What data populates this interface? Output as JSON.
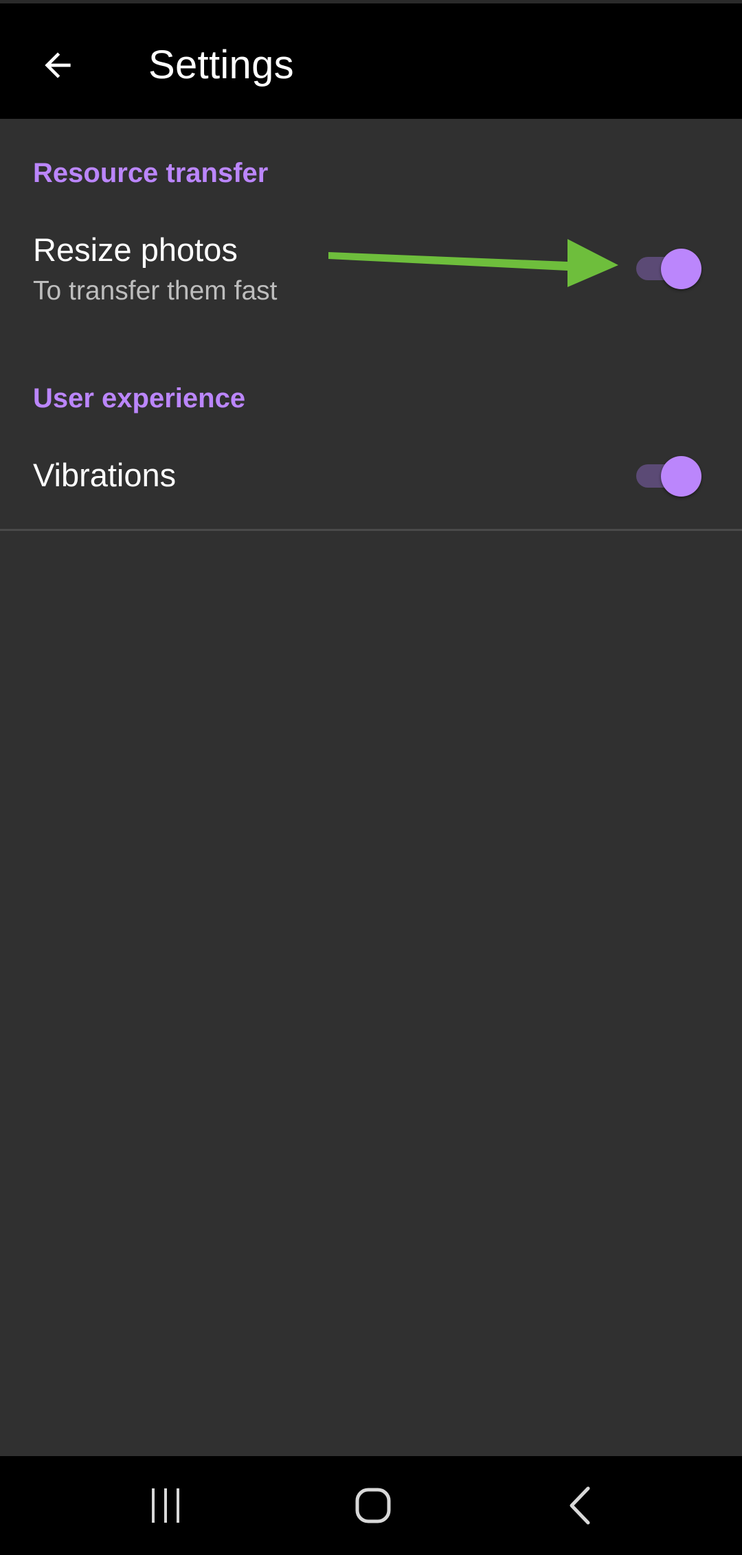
{
  "app_bar": {
    "title": "Settings",
    "back_icon": "arrow-back-icon"
  },
  "colors": {
    "accent": "#bb86fc",
    "track_on": "#5b4a75",
    "background": "#303030",
    "app_bar": "#000000",
    "annotation_arrow": "#6ebe3c"
  },
  "sections": [
    {
      "header": "Resource transfer",
      "items": [
        {
          "title": "Resize photos",
          "summary": "To transfer them fast",
          "toggle_on": true
        }
      ]
    },
    {
      "header": "User experience",
      "items": [
        {
          "title": "Vibrations",
          "toggle_on": true
        }
      ]
    }
  ],
  "annotation": {
    "icon": "green-arrow-icon"
  },
  "nav_bar": {
    "recents_icon": "recent-apps-icon",
    "home_icon": "home-icon",
    "back_icon": "system-back-icon"
  }
}
